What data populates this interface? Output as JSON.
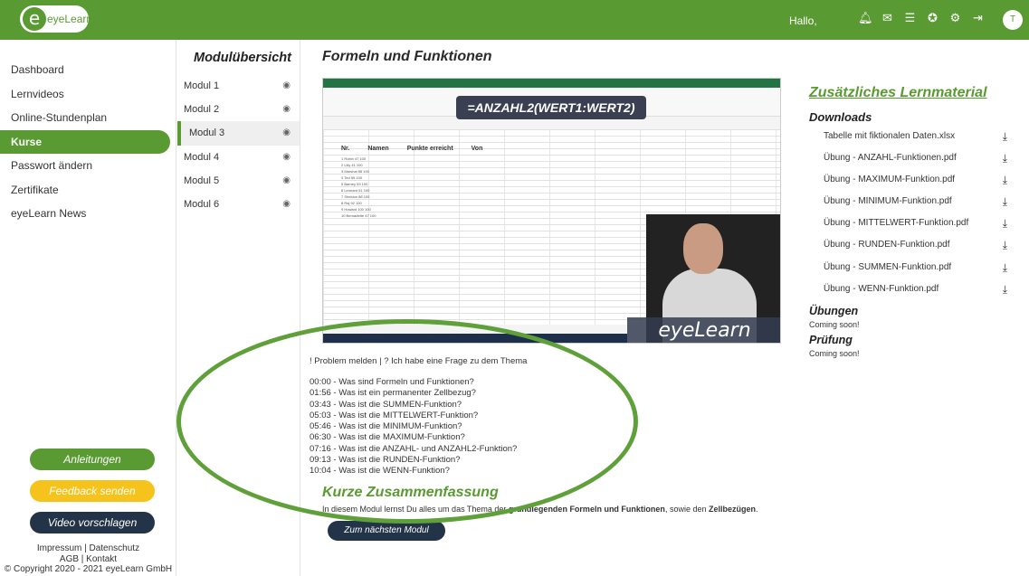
{
  "header": {
    "logo_text": "eyeLearn",
    "greeting": "Hallo,",
    "icons": [
      "bell-icon",
      "mail-icon",
      "sliders-icon",
      "support-icon",
      "gear-icon",
      "logout-icon"
    ],
    "avatar_initials": "T",
    "brand_color": "#5a9a32"
  },
  "sidebar": {
    "items": [
      {
        "label": "Dashboard"
      },
      {
        "label": "Lernvideos"
      },
      {
        "label": "Online-Stundenplan"
      },
      {
        "label": "Kurse",
        "active": true
      },
      {
        "label": "Passwort ändern"
      },
      {
        "label": "Zertifikate"
      },
      {
        "label": "eyeLearn News"
      }
    ],
    "buttons": {
      "anleitungen": "Anleitungen",
      "feedback": "Feedback senden",
      "video": "Video vorschlagen"
    },
    "footer": {
      "line1": "Impressum | Datenschutz",
      "line2": "AGB | Kontakt",
      "line3": "© Copyright 2020 - 2021 eyeLearn GmbH"
    }
  },
  "modules": {
    "title": "Modulübersicht",
    "items": [
      {
        "label": "Modul 1"
      },
      {
        "label": "Modul 2"
      },
      {
        "label": "Modul 3",
        "active": true
      },
      {
        "label": "Modul 4"
      },
      {
        "label": "Modul 5"
      },
      {
        "label": "Modul 6"
      }
    ]
  },
  "main": {
    "title": "Formeln und Funktionen",
    "video": {
      "formula": "=ANZAHL2(WERT1:WERT2)",
      "brand": "eyeLearn",
      "headers": [
        "Nr.",
        "Namen",
        "Punkte erreicht",
        "Von"
      ],
      "rows": [
        "1  Robin  47  100",
        "2  Lilly  41  100",
        "3  Marshal  88  100",
        "4  Ted  59  100",
        "5  Barney  53  100",
        "6  Leonard  51  100",
        "7  Sheldon  88  100",
        "8  Raj  92  100",
        "9  Howard  100  100",
        "10  Bernadette  47  100"
      ]
    },
    "problem_link": "! Problem melden | ? Ich habe eine Frage zu dem Thema",
    "chapters": [
      "00:00 - Was sind Formeln und Funktionen?",
      "01:56 - Was ist ein permanenter Zellbezug?",
      "03:43 - Was ist die SUMMEN-Funktion?",
      "05:03 - Was ist die MITTELWERT-Funktion?",
      "05:46 - Was ist die MINIMUM-Funktion?",
      "06:30 - Was ist die MAXIMUM-Funktion?",
      "07:16 - Was ist die ANZAHL- und ANZAHL2-Funktion?",
      "09:13 - Was ist die RUNDEN-Funktion?",
      "10:04 - Was ist die WENN-Funktion?"
    ],
    "summary_title": "Kurze Zusammenfassung",
    "summary_pre": "In diesem Modul lernst Du alles um das Thema der ",
    "summary_bold1": "grundlegenden Formeln und Funktionen",
    "summary_mid": ", sowie den ",
    "summary_bold2": "Zellbezügen",
    "summary_end": ".",
    "next_button": "Zum nächsten Modul"
  },
  "right": {
    "title": "Zusätzliches Lernmaterial",
    "downloads_head": "Downloads",
    "downloads": [
      "Tabelle mit fiktionalen Daten.xlsx",
      "Übung - ANZAHL-Funktionen.pdf",
      "Übung - MAXIMUM-Funktion.pdf",
      "Übung - MINIMUM-Funktion.pdf",
      "Übung - MITTELWERT-Funktion.pdf",
      "Übung - RUNDEN-Funktion.pdf",
      "Übung - SUMMEN-Funktion.pdf",
      "Übung - WENN-Funktion.pdf"
    ],
    "uebungen_head": "Übungen",
    "uebungen_text": "Coming soon!",
    "pruefung_head": "Prüfung",
    "pruefung_text": "Coming soon!"
  }
}
